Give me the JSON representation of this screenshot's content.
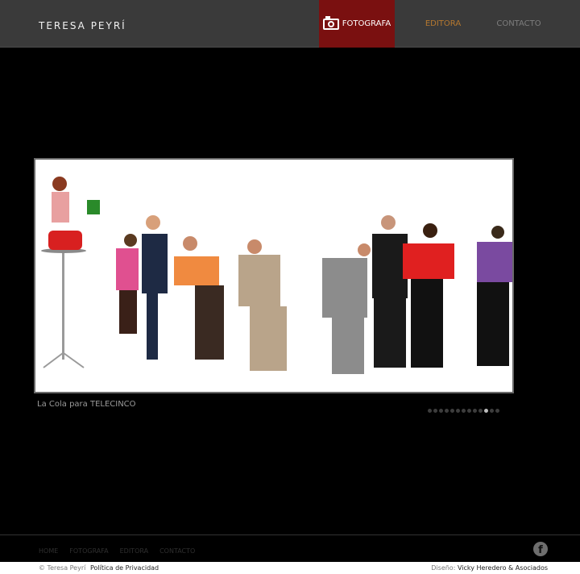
{
  "header": {
    "brand": "TERESA PEYRÍ",
    "nav": {
      "fotografa": "FOTOGRAFA",
      "editora": "EDITORA",
      "contacto": "CONTACTO"
    },
    "active_color": "#7a1010",
    "editora_color": "#b5782f"
  },
  "gallery": {
    "caption": "La Cola para TELECINCO",
    "slide_count": 13,
    "active_slide": 10
  },
  "footer": {
    "nav": [
      "HOME",
      "FOTOGRAFA",
      "EDITORA",
      "CONTACTO"
    ],
    "facebook_icon": "facebook-icon",
    "copyright": "© Teresa Peyrí",
    "privacy": "Política de Privacidad",
    "design_label": "Diseño:",
    "design_name": "Vicky Heredero & Asociados"
  }
}
